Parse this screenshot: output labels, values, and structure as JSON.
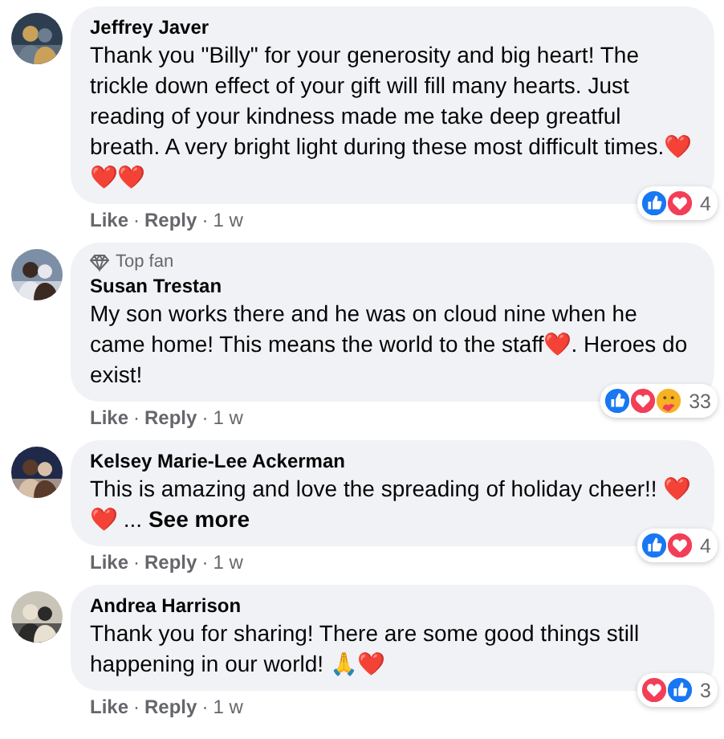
{
  "comments": [
    {
      "author": "Jeffrey Javer",
      "text": "Thank you \"Billy\" for your generosity and big heart! The trickle down effect of your gift will fill many hearts. Just reading of your kindness made me take deep greatful breath. A very bright light during these most difficult times.❤️❤️❤️",
      "actions": [
        {
          "kind": "link",
          "text": "Like"
        },
        {
          "kind": "separator",
          "text": "·"
        },
        {
          "kind": "link",
          "text": "Reply"
        },
        {
          "kind": "separator",
          "text": "·"
        },
        {
          "kind": "time",
          "text": "1 w"
        }
      ],
      "reactions": [
        {
          "kind": "like"
        },
        {
          "kind": "love"
        }
      ],
      "reaction_count": "4"
    },
    {
      "badge": "Top fan",
      "author": "Susan Trestan",
      "text": "My son works there and he was on cloud nine when he came home! This means the world to the staff❤️. Heroes do exist!",
      "actions": [
        {
          "kind": "link",
          "text": "Like"
        },
        {
          "kind": "separator",
          "text": "·"
        },
        {
          "kind": "link",
          "text": "Reply"
        },
        {
          "kind": "separator",
          "text": "·"
        },
        {
          "kind": "time",
          "text": "1 w"
        }
      ],
      "reactions": [
        {
          "kind": "like"
        },
        {
          "kind": "love"
        },
        {
          "kind": "care"
        }
      ],
      "reaction_count": "33"
    },
    {
      "author": "Kelsey Marie-Lee Ackerman",
      "text": "This is amazing and love the spreading of holiday cheer!! ❤️❤️ ...",
      "see_more": "See more",
      "actions": [
        {
          "kind": "link",
          "text": "Like"
        },
        {
          "kind": "separator",
          "text": "·"
        },
        {
          "kind": "link",
          "text": "Reply"
        },
        {
          "kind": "separator",
          "text": "·"
        },
        {
          "kind": "time",
          "text": "1 w"
        }
      ],
      "reactions": [
        {
          "kind": "like"
        },
        {
          "kind": "love"
        }
      ],
      "reaction_count": "4"
    },
    {
      "author": "Andrea Harrison",
      "text": "Thank you for sharing! There are some good things still happening in our world! 🙏❤️",
      "actions": [
        {
          "kind": "link",
          "text": "Like"
        },
        {
          "kind": "separator",
          "text": "·"
        },
        {
          "kind": "link",
          "text": "Reply"
        },
        {
          "kind": "separator",
          "text": "·"
        },
        {
          "kind": "time",
          "text": "1 w"
        }
      ],
      "reactions": [
        {
          "kind": "love"
        },
        {
          "kind": "like"
        }
      ],
      "reaction_count": "3"
    }
  ]
}
